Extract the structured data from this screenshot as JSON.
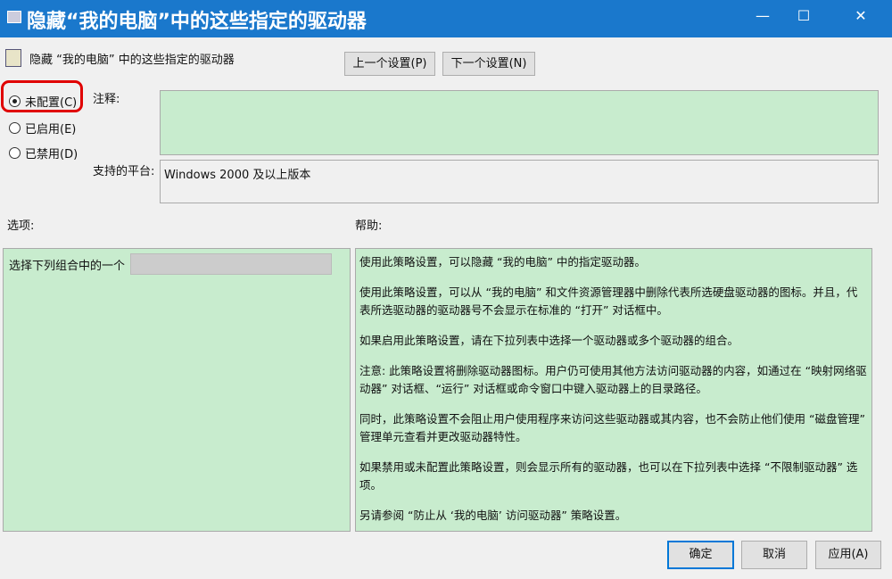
{
  "window": {
    "title": "隐藏“我的电脑”中的这些指定的驱动器",
    "minimize": "—",
    "maximize": "☐",
    "close": "✕"
  },
  "header": {
    "policy_name": "隐藏 “我的电脑” 中的这些指定的驱动器",
    "prev_button": "上一个设置(P)",
    "next_button": "下一个设置(N)"
  },
  "state": {
    "options": [
      "未配置(C)",
      "已启用(E)",
      "已禁用(D)"
    ],
    "selected": 0
  },
  "comment": {
    "label": "注释:",
    "value": ""
  },
  "platform": {
    "label": "支持的平台:",
    "value": "Windows 2000 及以上版本"
  },
  "options_section": {
    "label": "选项:",
    "combo_label": "选择下列组合中的一个",
    "combo_value": ""
  },
  "help_section": {
    "label": "帮助:",
    "paragraphs": [
      "使用此策略设置，可以隐藏 “我的电脑” 中的指定驱动器。",
      "使用此策略设置，可以从 “我的电脑” 和文件资源管理器中删除代表所选硬盘驱动器的图标。并且，代表所选驱动器的驱动器号不会显示在标准的 “打开” 对话框中。",
      "如果启用此策略设置，请在下拉列表中选择一个驱动器或多个驱动器的组合。",
      "注意: 此策略设置将删除驱动器图标。用户仍可使用其他方法访问驱动器的内容，如通过在 “映射网络驱动器” 对话框、“运行” 对话框或命令窗口中键入驱动器上的目录路径。",
      "同时，此策略设置不会阻止用户使用程序来访问这些驱动器或其内容，也不会防止他们使用 “磁盘管理” 管理单元查看并更改驱动器特性。",
      "如果禁用或未配置此策略设置，则会显示所有的驱动器，也可以在下拉列表中选择 “不限制驱动器” 选项。",
      "另请参阅 “防止从 ‘我的电脑’ 访问驱动器” 策略设置。"
    ]
  },
  "footer": {
    "ok": "确定",
    "cancel": "取消",
    "apply": "应用(A)"
  },
  "colors": {
    "titlebar": "#1a78cc",
    "panel": "#c8ecce",
    "highlight": "#e00000"
  }
}
